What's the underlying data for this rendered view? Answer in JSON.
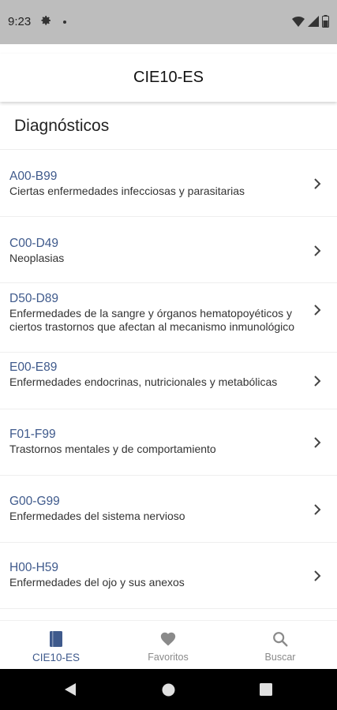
{
  "status_bar": {
    "time": "9:23"
  },
  "app_bar": {
    "title": "CIE10-ES"
  },
  "section": {
    "title": "Diagnósticos"
  },
  "diagnostics": [
    {
      "code": "A00-B99",
      "description": "Ciertas enfermedades infecciosas y parasitarias"
    },
    {
      "code": "C00-D49",
      "description": "Neoplasias"
    },
    {
      "code": "D50-D89",
      "description": "Enfermedades de la sangre y órganos hematopoyéticos y ciertos trastornos que afectan al mecanismo inmunológico"
    },
    {
      "code": "E00-E89",
      "description": "Enfermedades endocrinas, nutricionales y metabólicas"
    },
    {
      "code": "F01-F99",
      "description": "Trastornos mentales y de comportamiento"
    },
    {
      "code": "G00-G99",
      "description": "Enfermedades del sistema nervioso"
    },
    {
      "code": "H00-H59",
      "description": "Enfermedades del ojo y sus anexos"
    }
  ],
  "bottom_nav": {
    "tabs": [
      {
        "label": "CIE10-ES",
        "icon": "book-icon",
        "active": true
      },
      {
        "label": "Favoritos",
        "icon": "heart-icon",
        "active": false
      },
      {
        "label": "Buscar",
        "icon": "search-icon",
        "active": false
      }
    ]
  },
  "colors": {
    "accent": "#3f5a8c",
    "status_bar": "#bdbdbd"
  }
}
